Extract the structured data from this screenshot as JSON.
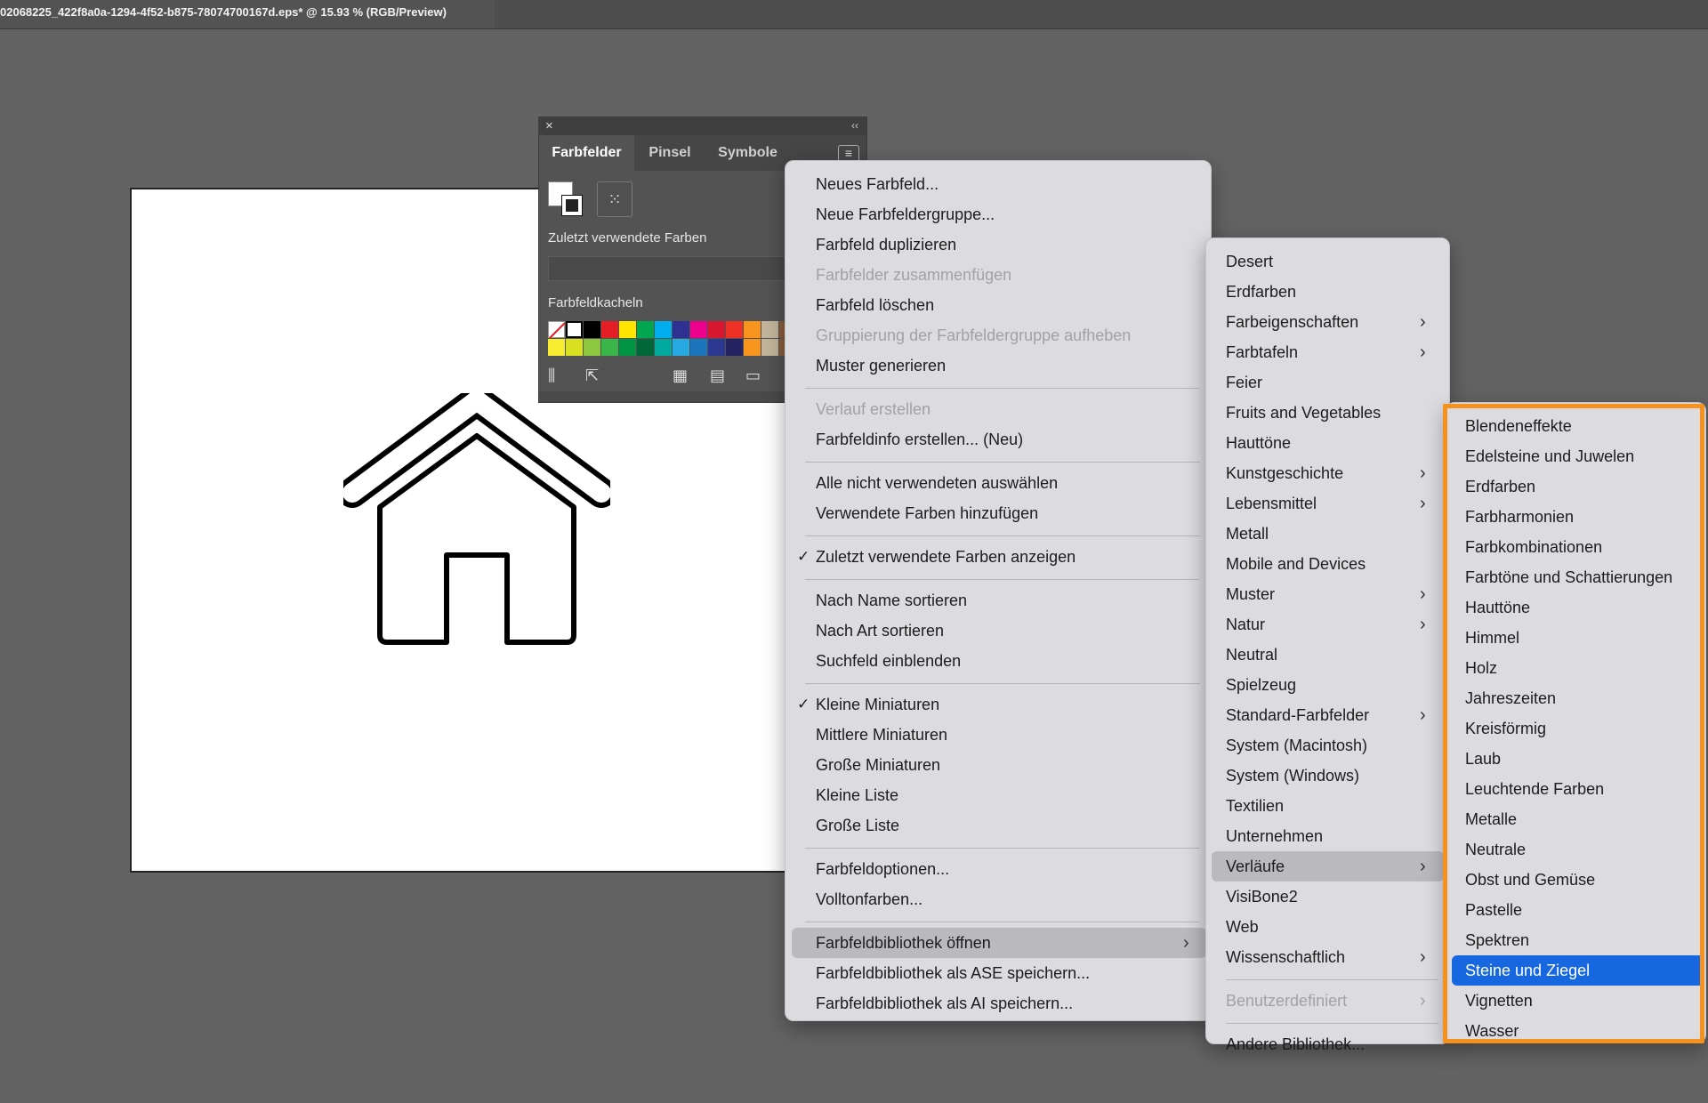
{
  "window": {
    "document_title": "02068225_422f8a0a-1294-4f52-b875-78074700167d.eps* @ 15.93 % (RGB/Preview)"
  },
  "swatches_panel": {
    "tabs": [
      "Farbfelder",
      "Pinsel",
      "Symbole"
    ],
    "active_tab": "Farbfelder",
    "recent_label": "Zuletzt verwendete Farben",
    "tiles_label": "Farbfeldkacheln",
    "swatch_colors_row1": [
      "none",
      "#ffffff",
      "#000000",
      "#e51e25",
      "#ffe500",
      "#00a650",
      "#00aeef",
      "#2e3192",
      "#ec008c",
      "#d7172f",
      "#ee3124"
    ],
    "swatch_colors_row2": [
      "#f8ec31",
      "#d9e021",
      "#8dc63f",
      "#39b54a",
      "#009444",
      "#006838",
      "#00a99d",
      "#27aae1",
      "#1c75bc",
      "#2b3990",
      "#262262"
    ]
  },
  "menu_main": {
    "items": [
      {
        "label": "Neues Farbfeld...",
        "disabled": false
      },
      {
        "label": "Neue Farbfeldergruppe...",
        "disabled": false
      },
      {
        "label": "Farbfeld duplizieren",
        "disabled": false
      },
      {
        "label": "Farbfelder zusammenfügen",
        "disabled": true
      },
      {
        "label": "Farbfeld löschen",
        "disabled": false
      },
      {
        "label": "Gruppierung der Farbfeldergruppe aufheben",
        "disabled": true
      },
      {
        "label": "Muster generieren",
        "disabled": false
      },
      {
        "label": "Verlauf erstellen",
        "disabled": true
      },
      {
        "label": "Farbfeldinfo erstellen... (Neu)",
        "disabled": false
      },
      {
        "label": "Alle nicht verwendeten auswählen",
        "disabled": false
      },
      {
        "label": "Verwendete Farben hinzufügen",
        "disabled": false
      },
      {
        "label": "Zuletzt verwendete Farben anzeigen",
        "disabled": false,
        "checked": true
      },
      {
        "label": "Nach Name sortieren",
        "disabled": false
      },
      {
        "label": "Nach Art sortieren",
        "disabled": false
      },
      {
        "label": "Suchfeld einblenden",
        "disabled": false
      },
      {
        "label": "Kleine Miniaturen",
        "disabled": false,
        "checked": true
      },
      {
        "label": "Mittlere Miniaturen",
        "disabled": false
      },
      {
        "label": "Große Miniaturen",
        "disabled": false
      },
      {
        "label": "Kleine Liste",
        "disabled": false
      },
      {
        "label": "Große Liste",
        "disabled": false
      },
      {
        "label": "Farbfeldoptionen...",
        "disabled": false
      },
      {
        "label": "Volltonfarben...",
        "disabled": false
      },
      {
        "label": "Farbfeldbibliothek öffnen",
        "disabled": false,
        "submenu": true,
        "highlighted": true
      },
      {
        "label": "Farbfeldbibliothek als ASE speichern...",
        "disabled": false
      },
      {
        "label": "Farbfeldbibliothek als AI speichern...",
        "disabled": false
      }
    ]
  },
  "menu_library": {
    "items": [
      {
        "label": "Desert"
      },
      {
        "label": "Erdfarben"
      },
      {
        "label": "Farbeigenschaften",
        "submenu": true
      },
      {
        "label": "Farbtafeln",
        "submenu": true
      },
      {
        "label": "Feier"
      },
      {
        "label": "Fruits and Vegetables"
      },
      {
        "label": "Hauttöne"
      },
      {
        "label": "Kunstgeschichte",
        "submenu": true
      },
      {
        "label": "Lebensmittel",
        "submenu": true
      },
      {
        "label": "Metall"
      },
      {
        "label": "Mobile and Devices"
      },
      {
        "label": "Muster",
        "submenu": true
      },
      {
        "label": "Natur",
        "submenu": true
      },
      {
        "label": "Neutral"
      },
      {
        "label": "Spielzeug"
      },
      {
        "label": "Standard-Farbfelder",
        "submenu": true
      },
      {
        "label": "System (Macintosh)"
      },
      {
        "label": "System (Windows)"
      },
      {
        "label": "Textilien"
      },
      {
        "label": "Unternehmen"
      },
      {
        "label": "Verläufe",
        "submenu": true,
        "highlighted": true
      },
      {
        "label": "VisiBone2"
      },
      {
        "label": "Web"
      },
      {
        "label": "Wissenschaftlich",
        "submenu": true
      },
      {
        "label": "Benutzerdefiniert",
        "submenu": true,
        "disabled": true
      },
      {
        "label": "Andere Bibliothek..."
      }
    ]
  },
  "menu_gradients": {
    "items": [
      {
        "label": "Blendeneffekte"
      },
      {
        "label": "Edelsteine und Juwelen"
      },
      {
        "label": "Erdfarben"
      },
      {
        "label": "Farbharmonien"
      },
      {
        "label": "Farbkombinationen"
      },
      {
        "label": "Farbtöne und Schattierungen"
      },
      {
        "label": "Hauttöne"
      },
      {
        "label": "Himmel"
      },
      {
        "label": "Holz"
      },
      {
        "label": "Jahreszeiten"
      },
      {
        "label": "Kreisförmig"
      },
      {
        "label": "Laub"
      },
      {
        "label": "Leuchtende Farben"
      },
      {
        "label": "Metalle"
      },
      {
        "label": "Neutrale"
      },
      {
        "label": "Obst und Gemüse"
      },
      {
        "label": "Pastelle"
      },
      {
        "label": "Spektren"
      },
      {
        "label": "Steine und Ziegel",
        "selected": true
      },
      {
        "label": "Vignetten"
      },
      {
        "label": "Wasser"
      }
    ]
  },
  "colors": {
    "highlight_orange": "#f5921e",
    "selection_blue": "#1667e0"
  }
}
